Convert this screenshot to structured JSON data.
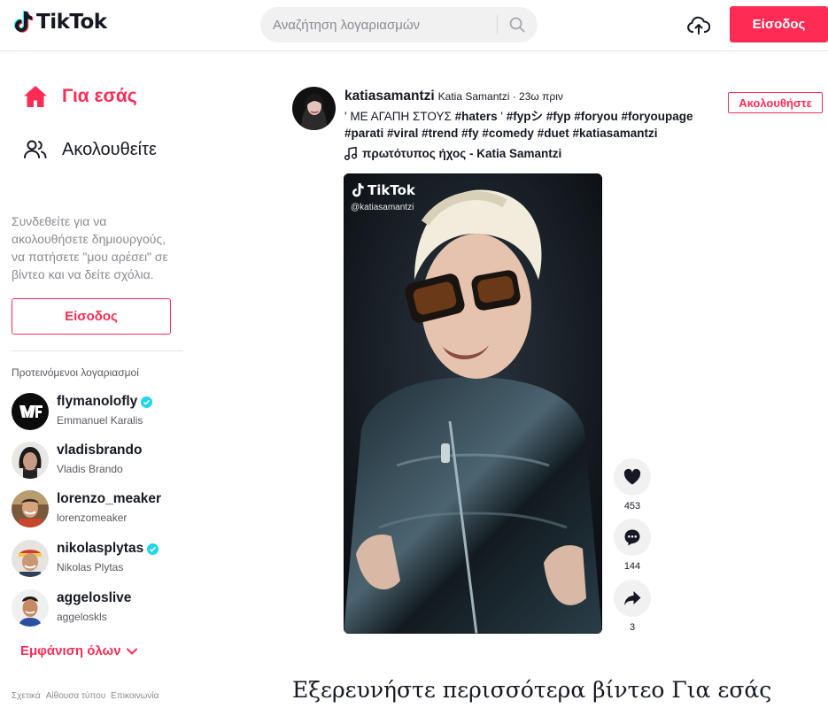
{
  "brand": {
    "name": "TikTok",
    "accent": "#fe2c55",
    "cyan": "#25f4ee"
  },
  "header": {
    "search_placeholder": "Αναζήτηση λογαριασμών",
    "login_label": "Είσοδος",
    "icons": {
      "search": "search-icon",
      "upload": "upload-cloud-icon"
    }
  },
  "sidebar": {
    "nav": [
      {
        "label": "Για εσάς",
        "icon": "home-icon",
        "active": true
      },
      {
        "label": "Ακολουθείτε",
        "icon": "users-icon",
        "active": false
      }
    ],
    "hint": "Συνδεθείτε για να ακολουθήσετε δημιουργούς, να πατήσετε \"μου αρέσει\" σε βίντεο και να δείτε σχόλια.",
    "login_label": "Είσοδος",
    "suggested_title": "Προτεινόμενοι λογαριασμοί",
    "accounts": [
      {
        "username": "flymanolofly",
        "name": "Emmanuel Karalis",
        "verified": true
      },
      {
        "username": "vladisbrando",
        "name": "Vladis Brando",
        "verified": false
      },
      {
        "username": "lorenzo_meaker",
        "name": "lorenzomeaker",
        "verified": false
      },
      {
        "username": "nikolasplytas",
        "name": "Nikolas Plytas",
        "verified": true
      },
      {
        "username": "aggeloslive",
        "name": "aggeloskls",
        "verified": false
      }
    ],
    "see_all": "Εμφάνιση όλων",
    "footer": [
      "Σχετικά",
      "Αίθουσα τύπου",
      "Επικοινωνία"
    ]
  },
  "post": {
    "username": "katiasamantzi",
    "meta": "Katia Samantzi · 23ω πριν",
    "caption_lines": [
      [
        "' ΜΕ ΑΓΑΠΗ ΣΤΟΥΣ ",
        "#haters",
        " ' ",
        "#fypシ",
        " ",
        "#fyp",
        " ",
        "#foryou",
        " ",
        "#foryoupage"
      ],
      [
        "#parati",
        " ",
        "#viral",
        " ",
        "#trend",
        " ",
        "#fy",
        " ",
        "#comedy",
        " ",
        "#duet",
        " ",
        "#katiasamantzi"
      ]
    ],
    "music": "πρωτότυπος ήχος - Katia Samantzi",
    "follow_label": "Ακολουθήστε",
    "video": {
      "watermark": "TikTok",
      "watermark_user": "@katiasamantzi"
    },
    "actions": [
      {
        "icon": "heart-icon",
        "count": "453"
      },
      {
        "icon": "comment-icon",
        "count": "144"
      },
      {
        "icon": "share-icon",
        "count": "3"
      }
    ]
  },
  "explore_heading": "Εξερευνήστε περισσότερα βίντεο Για εσάς"
}
